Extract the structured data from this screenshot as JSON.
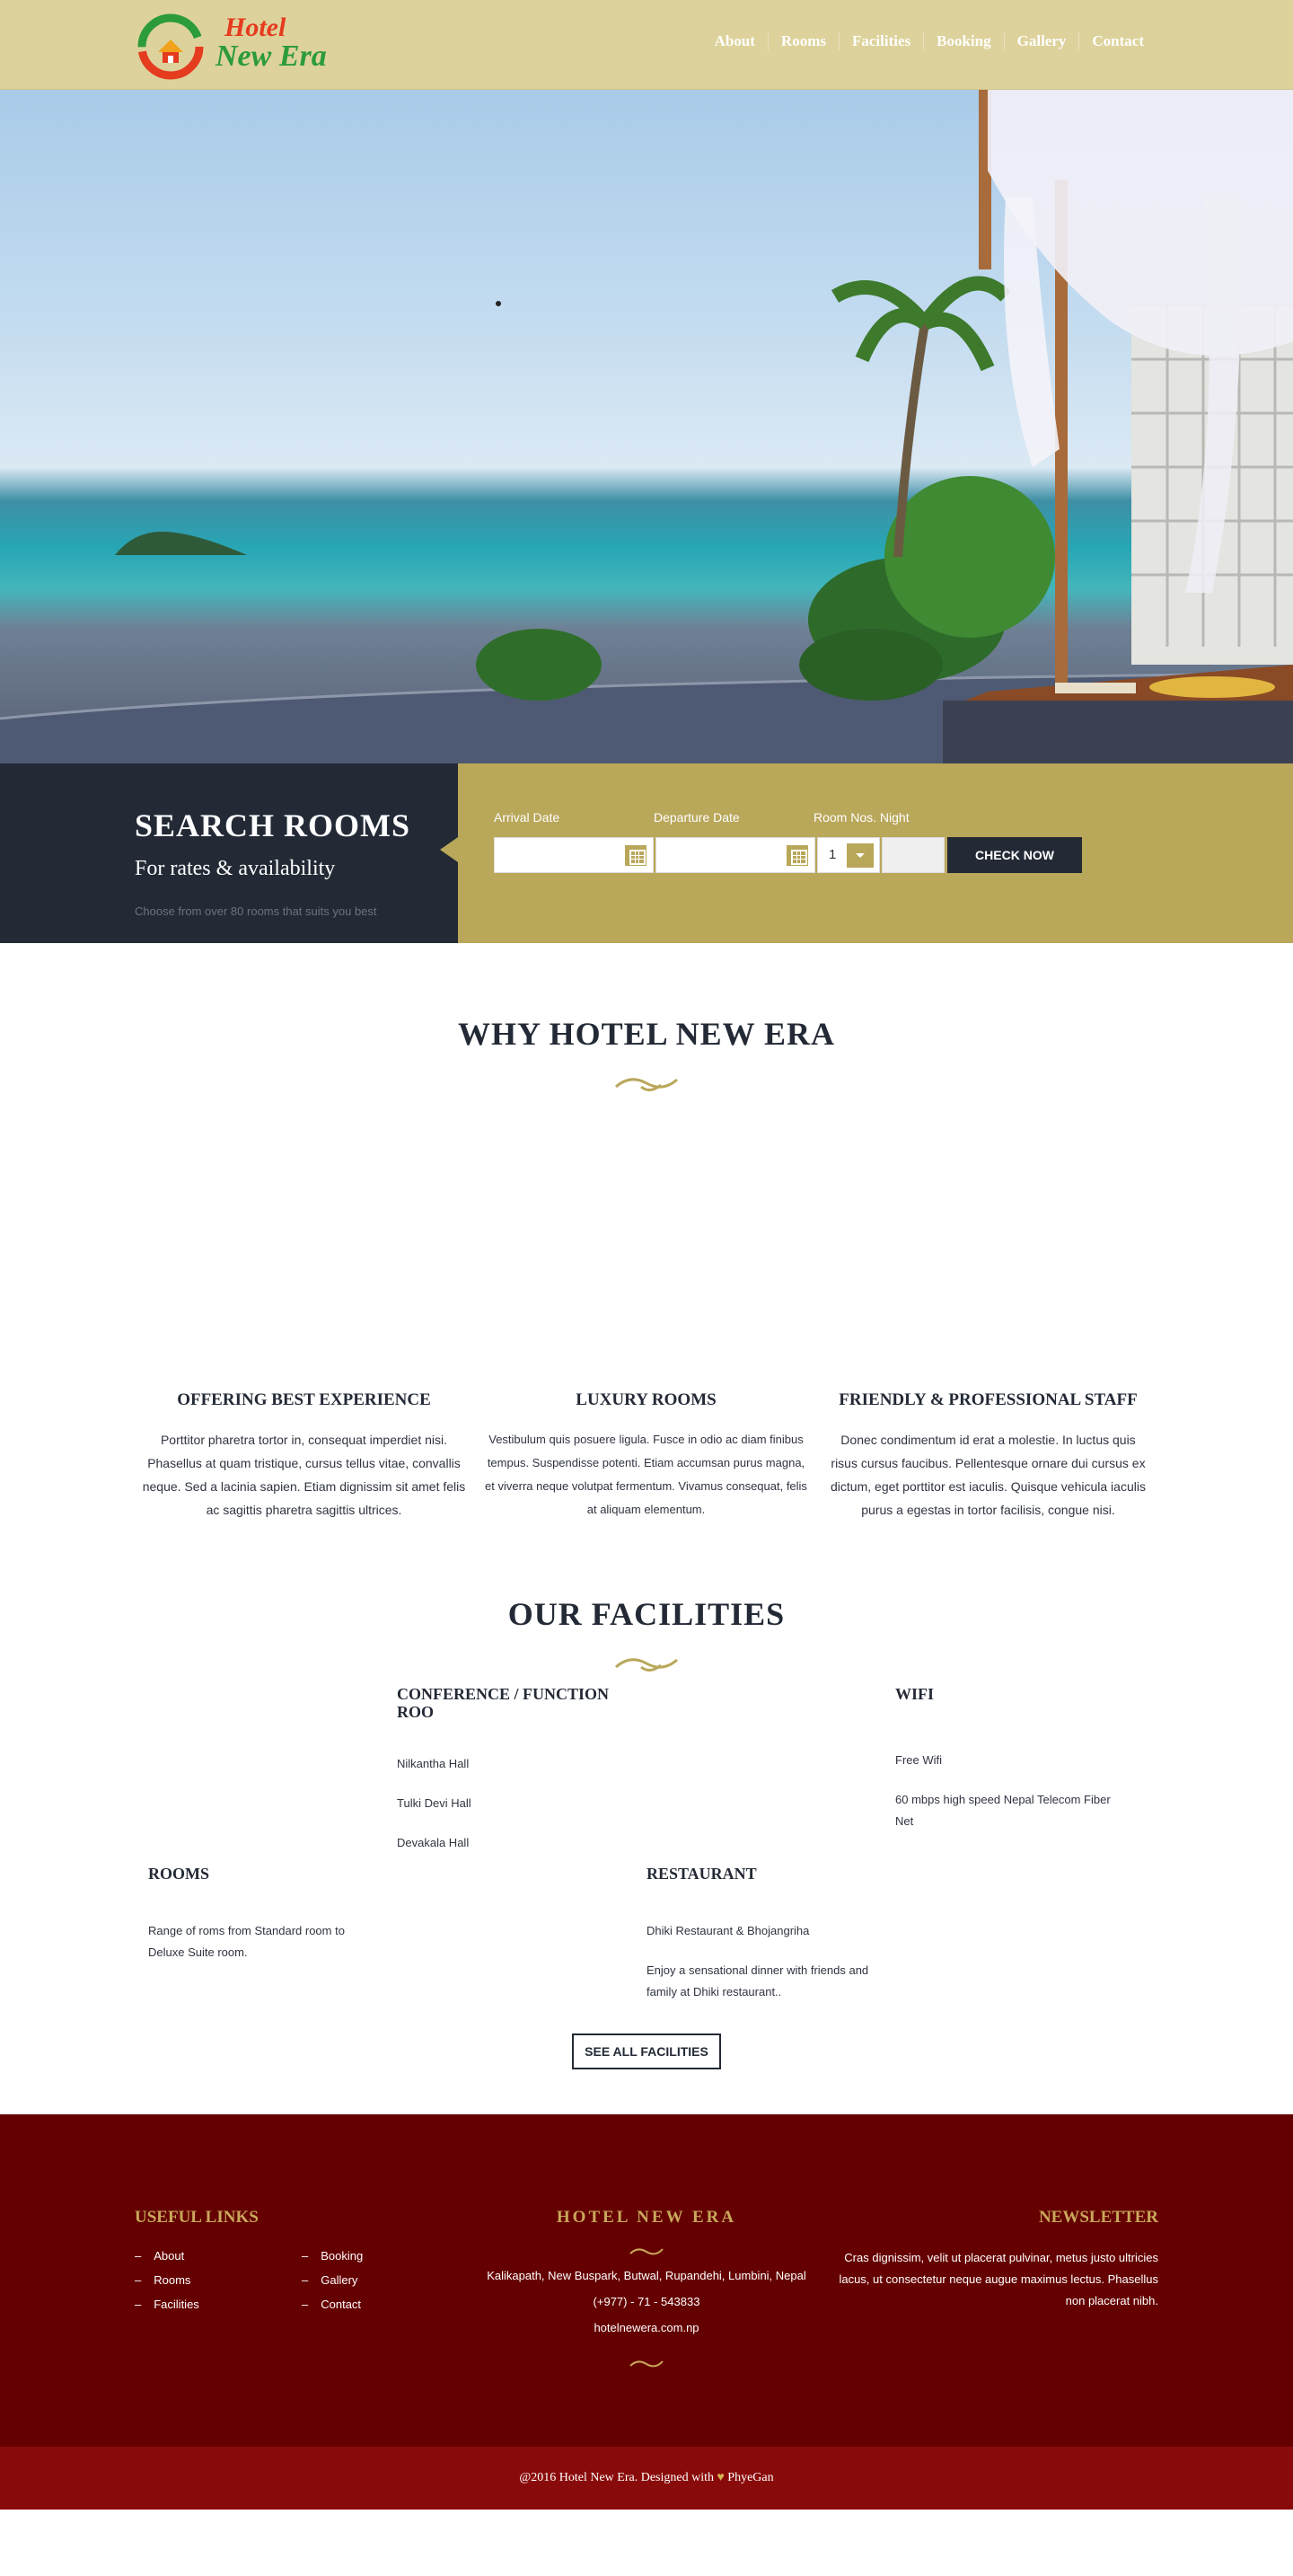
{
  "brand": {
    "line1": "Hotel",
    "line2": "New Era"
  },
  "nav": [
    "About",
    "Rooms",
    "Facilities",
    "Booking",
    "Gallery",
    "Contact"
  ],
  "search": {
    "title": "SEARCH ROOMS",
    "subtitle": "For rates & availability",
    "note": "Choose from over 80 rooms that suits you best",
    "arrival_label": "Arrival Date",
    "departure_label": "Departure Date",
    "rooms_label": "Room Nos. Night",
    "rooms_value": "1",
    "button": "CHECK NOW"
  },
  "why": {
    "title": "WHY HOTEL NEW ERA",
    "features": [
      {
        "title": "OFFERING BEST EXPERIENCE",
        "text": "Porttitor pharetra tortor in, consequat imperdiet nisi. Phasellus at quam tristique, cursus tellus vitae, convallis neque. Sed a lacinia sapien. Etiam dignissim sit amet felis ac sagittis pharetra sagittis ultrices."
      },
      {
        "title": "LUXURY ROOMS",
        "text": "Vestibulum quis posuere ligula. Fusce in odio ac diam finibus tempus. Suspendisse potenti. Etiam accumsan purus magna, et viverra neque volutpat fermentum. Vivamus consequat, felis at aliquam elementum."
      },
      {
        "title": "FRIENDLY & PROFESSIONAL STAFF",
        "text": "Donec condimentum id erat a molestie. In luctus quis risus cursus faucibus. Pellentesque ornare dui cursus ex dictum, eget porttitor est iaculis. Quisque vehicula iaculis purus a egestas in tortor facilisis, congue nisi."
      }
    ]
  },
  "facilities": {
    "title": "OUR FACILITIES",
    "items": [
      {
        "title": "CONFERENCE / FUNCTION ROO",
        "lines": [
          "Nilkantha Hall",
          "Tulki Devi Hall",
          "Devakala Hall"
        ]
      },
      {
        "title": "WIFI",
        "lines": [
          "Free Wifi",
          "60 mbps high speed Nepal Telecom Fiber Net"
        ]
      },
      {
        "title": "ROOMS",
        "lines": [
          "Range of roms from Standard room to Deluxe Suite room."
        ]
      },
      {
        "title": "RESTAURANT",
        "lines": [
          "Dhiki Restaurant & Bhojangriha",
          "Enjoy a sensational dinner with friends and family at Dhiki restaurant.."
        ]
      }
    ],
    "button": "SEE ALL FACILITIES"
  },
  "footer": {
    "links_title": "USEFUL LINKS",
    "links_col1": [
      "About",
      "Rooms",
      "Facilities"
    ],
    "links_col2": [
      "Booking",
      "Gallery",
      "Contact"
    ],
    "hotel_title": "HOTEL NEW ERA",
    "address": "Kalikapath, New Buspark, Butwal, Rupandehi, Lumbini, Nepal",
    "phone": "(+977) - 71 - 543833",
    "web": "hotelnewera.com.np",
    "news_title": "NEWSLETTER",
    "news_text": "Cras dignissim, velit ut placerat pulvinar, metus justo ultricies lacus, ut consectetur neque augue maximus lectus. Phasellus non placerat nibh.",
    "copy_pre": "@2016 Hotel New Era. Designed with",
    "copy_post": "PhyeGan"
  },
  "colors": {
    "header": "#ddd29b",
    "dark": "#232a36",
    "gold": "#b9a75a",
    "footer": "#650000",
    "bottom": "#890a0a"
  }
}
